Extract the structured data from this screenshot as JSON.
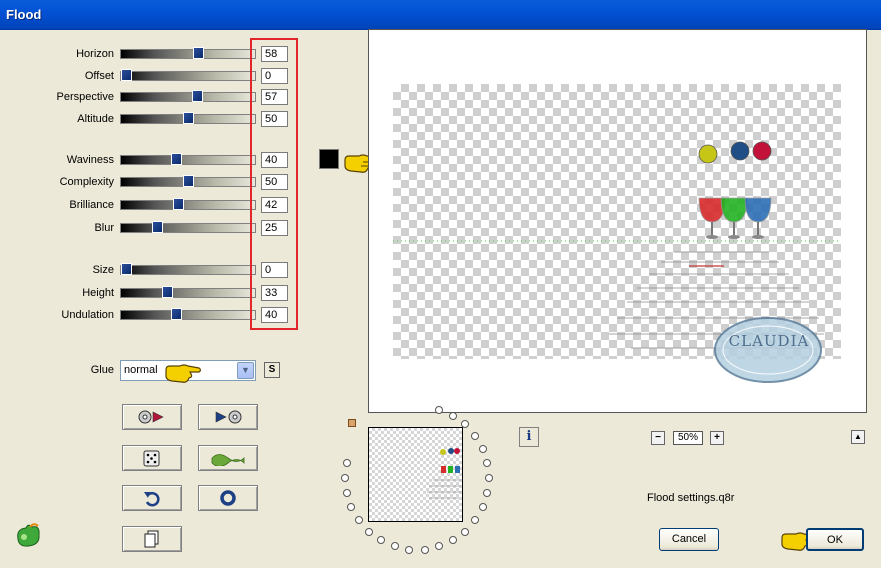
{
  "window": {
    "title": "Flood"
  },
  "params": [
    {
      "label": "Horizon",
      "value": "58",
      "level": 58
    },
    {
      "label": "Offset",
      "value": "0",
      "level": 0
    },
    {
      "label": "Perspective",
      "value": "57",
      "level": 57
    },
    {
      "label": "Altitude",
      "value": "50",
      "level": 50
    },
    {
      "label": "Waviness",
      "value": "40",
      "level": 40
    },
    {
      "label": "Complexity",
      "value": "50",
      "level": 50
    },
    {
      "label": "Brilliance",
      "value": "42",
      "level": 42
    },
    {
      "label": "Blur",
      "value": "25",
      "level": 25
    },
    {
      "label": "Size",
      "value": "0",
      "level": 0
    },
    {
      "label": "Height",
      "value": "33",
      "level": 33
    },
    {
      "label": "Undulation",
      "value": "40",
      "level": 40
    }
  ],
  "color": {
    "hex": "#000000",
    "swatch": "#000000"
  },
  "glue": {
    "label": "Glue",
    "selected": "normal",
    "s_button": "S"
  },
  "preview": {
    "zoom": "50%",
    "watermark": "CLAUDIA"
  },
  "status": {
    "filename": "Flood settings.q8r"
  },
  "buttons": {
    "cancel": "Cancel",
    "ok": "OK"
  },
  "colors": {
    "title_bar": "#0352d6",
    "highlight_box": "#e3262b",
    "pointer_hand": "#f5d000"
  }
}
